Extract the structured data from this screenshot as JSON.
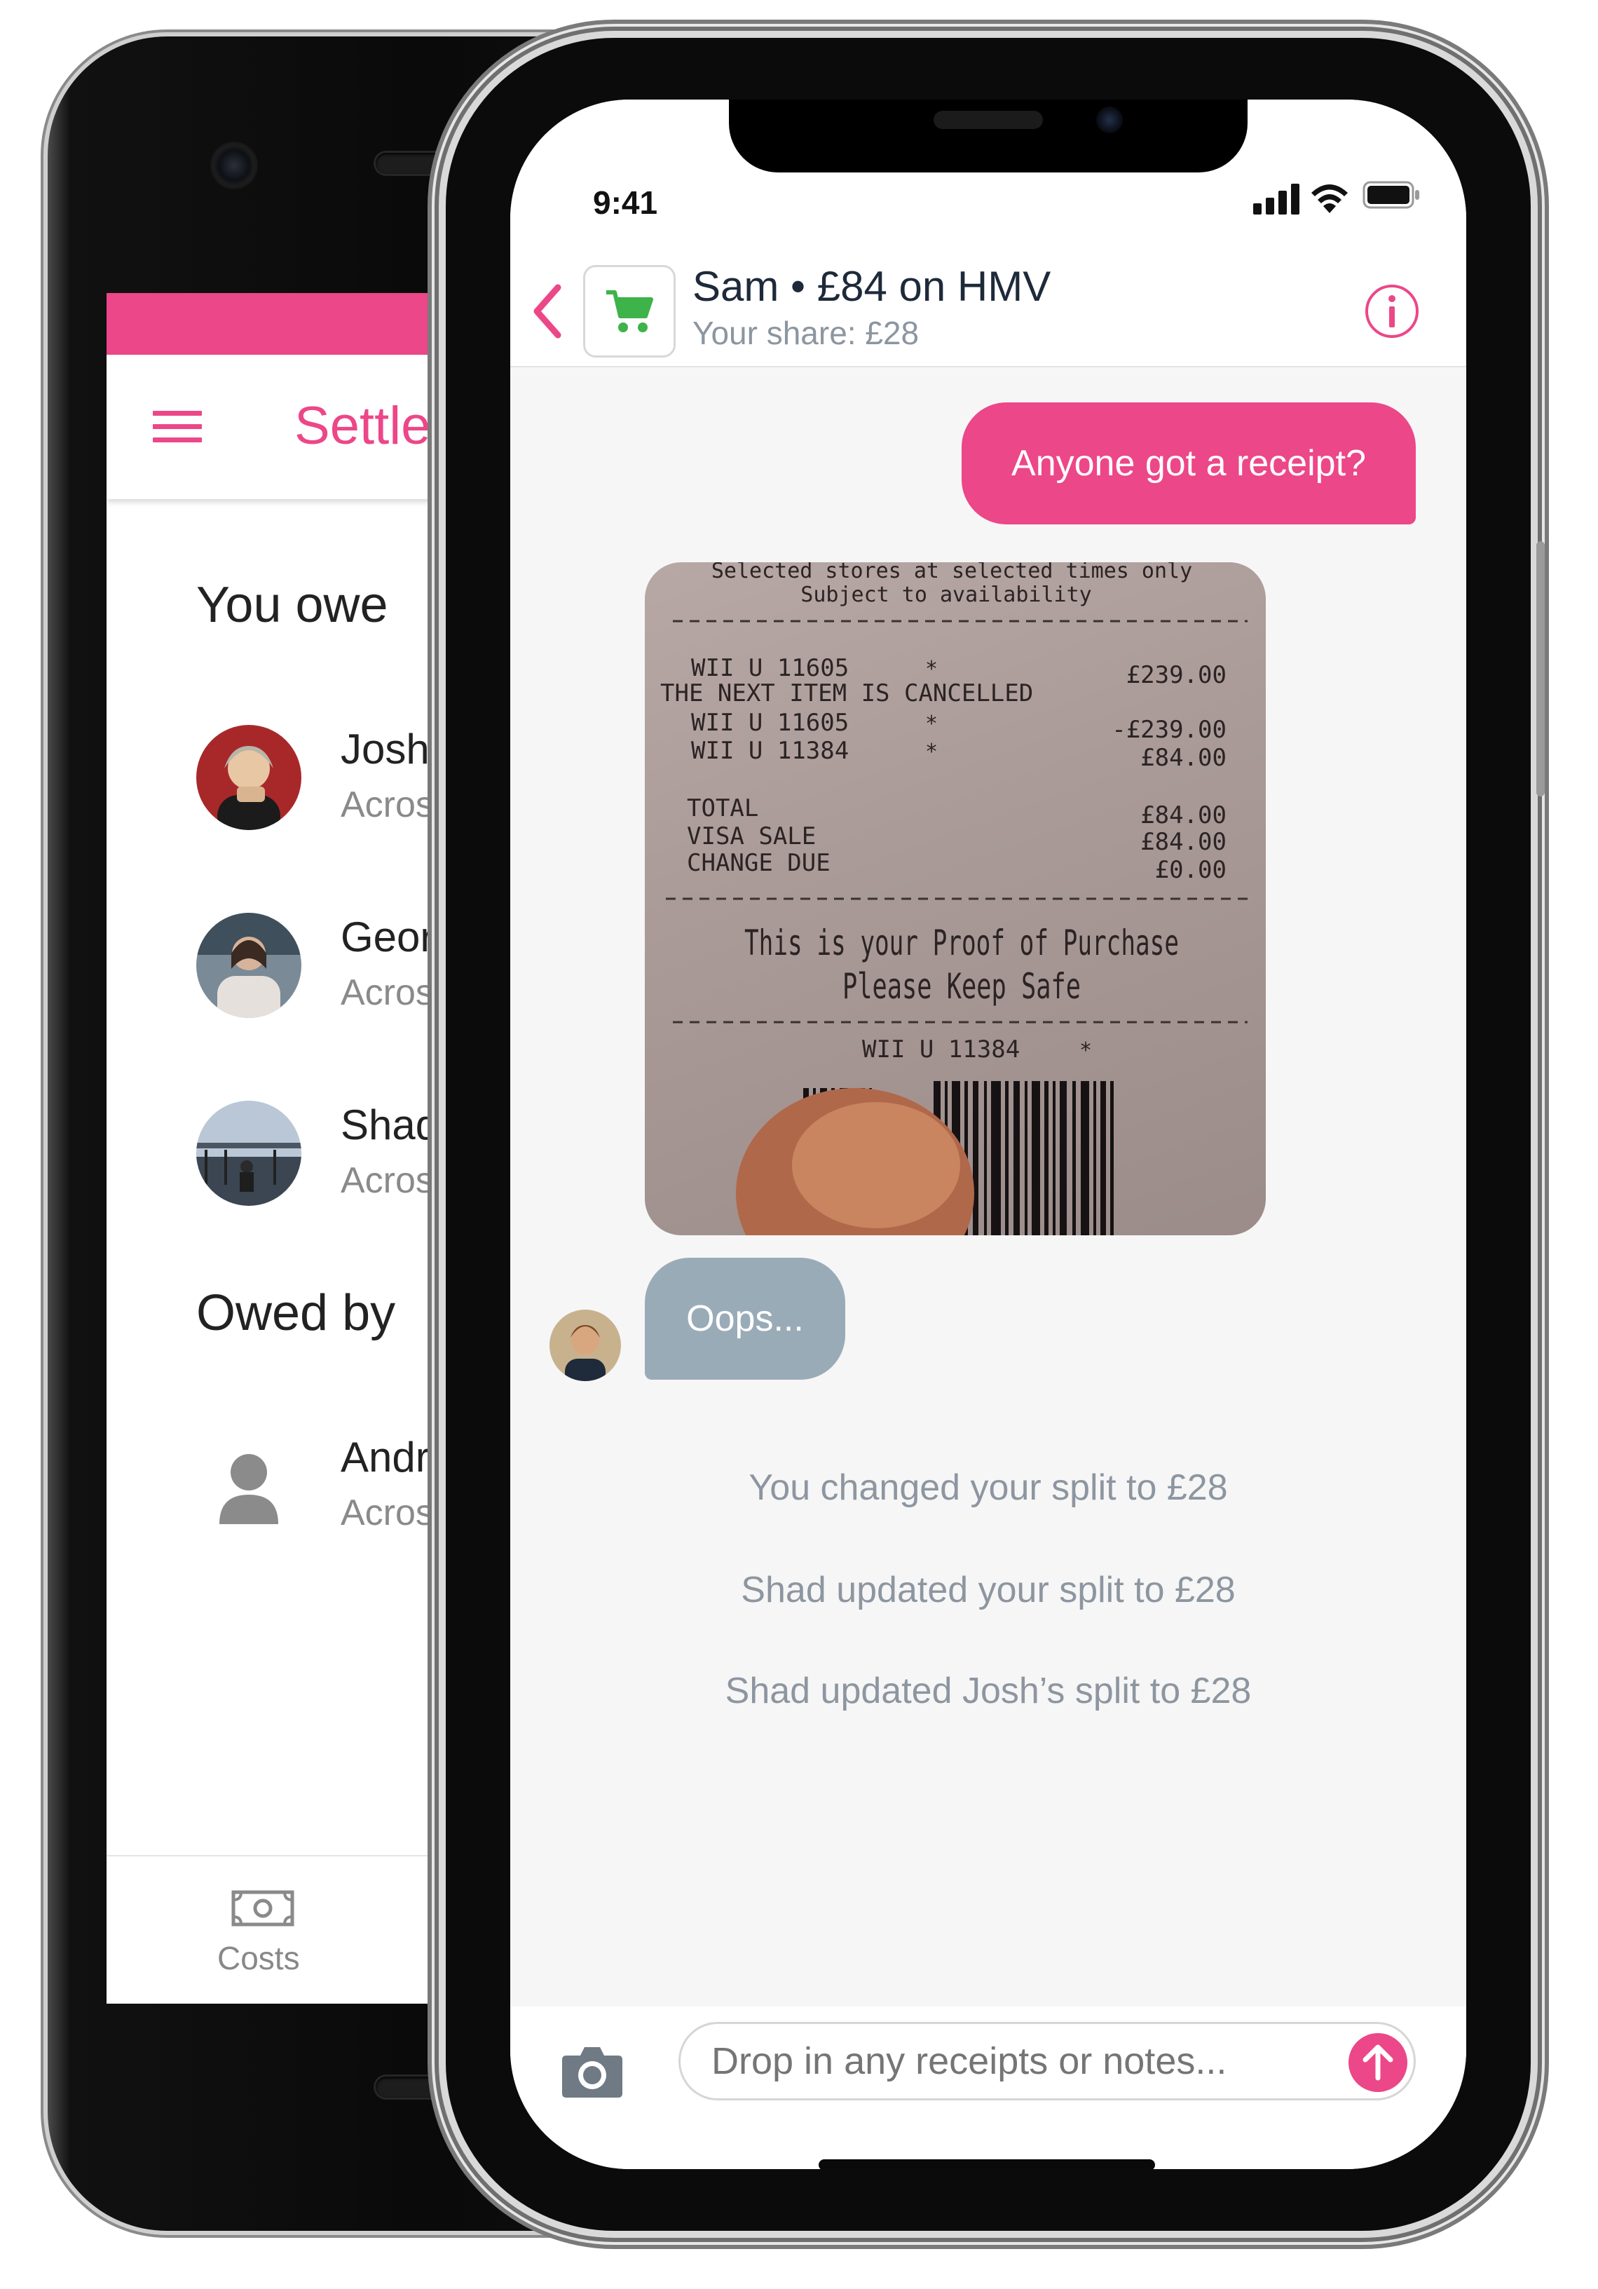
{
  "android": {
    "app_title": "Settle",
    "you_owe_heading": "You owe",
    "owed_by_heading": "Owed by",
    "you_owe": [
      {
        "name": "Josh",
        "subtitle": "Across 2"
      },
      {
        "name": "Georgia",
        "subtitle": "Across 3"
      },
      {
        "name": "Shad",
        "subtitle": "Across 1"
      }
    ],
    "owed_by": [
      {
        "name": "Andreas",
        "subtitle": "Across 2"
      }
    ],
    "bottom_nav": {
      "costs_label": "Costs"
    },
    "colors": {
      "brand": "#ec4788"
    }
  },
  "ios": {
    "status_bar": {
      "time": "9:41"
    },
    "header": {
      "title": "Sam • £84 on HMV",
      "subtitle": "Your share: £28",
      "category_icon": "shopping-cart-icon",
      "info_icon": "info-icon"
    },
    "messages": {
      "outgoing_text": "Anyone got a receipt?",
      "incoming_text": "Oops..."
    },
    "receipt": {
      "line1": "Selected stores at selected times only",
      "line2": "Subject to availability",
      "items": [
        {
          "desc": "WII U  11605",
          "mark": "*",
          "amount": "£239.00"
        },
        {
          "desc": "THE NEXT ITEM IS CANCELLED",
          "mark": "",
          "amount": ""
        },
        {
          "desc": "WII U  11605",
          "mark": "*",
          "amount": "-£239.00"
        },
        {
          "desc": "WII U 11384",
          "mark": "*",
          "amount": "£84.00"
        }
      ],
      "totals": [
        {
          "label": "TOTAL",
          "amount": "£84.00"
        },
        {
          "label": "VISA SALE",
          "amount": "£84.00"
        },
        {
          "label": "CHANGE DUE",
          "amount": "£0.00"
        }
      ],
      "proof_line1": "This is your Proof of Purchase",
      "proof_line2": "Please Keep Safe",
      "footer_item": "WII U  11384",
      "footer_mark": "*"
    },
    "system_messages": [
      "You changed your split to £28",
      "Shad updated your split to £28",
      "Shad updated Josh’s split to £28"
    ],
    "composer": {
      "placeholder": "Drop in any receipts or notes..."
    },
    "colors": {
      "accent": "#ec4788",
      "incoming_bubble": "#9aabb8",
      "cart_green": "#3db34a"
    }
  }
}
